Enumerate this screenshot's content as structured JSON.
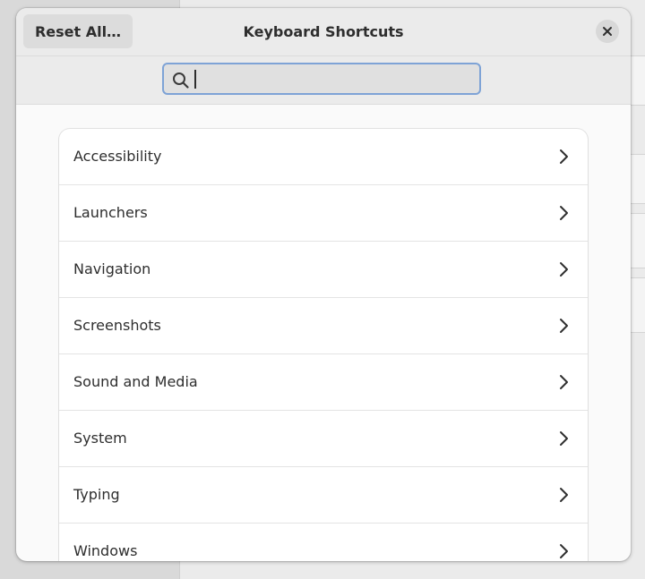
{
  "dialog": {
    "title": "Keyboard Shortcuts",
    "reset_label": "Reset All…",
    "close_icon": "close-icon"
  },
  "search": {
    "value": "",
    "placeholder": "",
    "icon": "search-icon"
  },
  "categories": [
    {
      "label": "Accessibility",
      "icon": "chevron-right-icon"
    },
    {
      "label": "Launchers",
      "icon": "chevron-right-icon"
    },
    {
      "label": "Navigation",
      "icon": "chevron-right-icon"
    },
    {
      "label": "Screenshots",
      "icon": "chevron-right-icon"
    },
    {
      "label": "Sound and Media",
      "icon": "chevron-right-icon"
    },
    {
      "label": "System",
      "icon": "chevron-right-icon"
    },
    {
      "label": "Typing",
      "icon": "chevron-right-icon"
    },
    {
      "label": "Windows",
      "icon": "chevron-right-icon"
    }
  ],
  "colors": {
    "accent": "#7ea3d6",
    "header_bg": "#ebebeb",
    "content_bg": "#fafafa",
    "list_bg": "#ffffff",
    "text": "#2e2e2e"
  }
}
